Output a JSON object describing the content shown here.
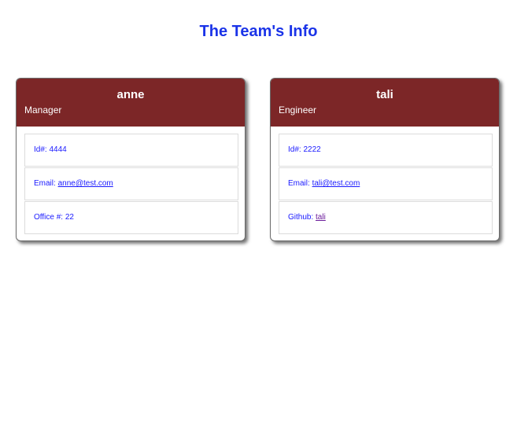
{
  "page": {
    "title": "The Team's Info"
  },
  "colors": {
    "title": "#1a33e8",
    "card_header": "#7c2627",
    "info_text": "#1a1aff"
  },
  "cards": [
    {
      "name": "anne",
      "role": "Manager",
      "id_label": "Id#:",
      "id_value": "4444",
      "email_label": "Email:",
      "email_value": "anne@test.com",
      "extra_label": "Office #:",
      "extra_value": "22"
    },
    {
      "name": "tali",
      "role": "Engineer",
      "id_label": "Id#:",
      "id_value": "2222",
      "email_label": "Email:",
      "email_value": "tali@test.com",
      "extra_label": "Github:",
      "extra_value": "tali"
    }
  ]
}
